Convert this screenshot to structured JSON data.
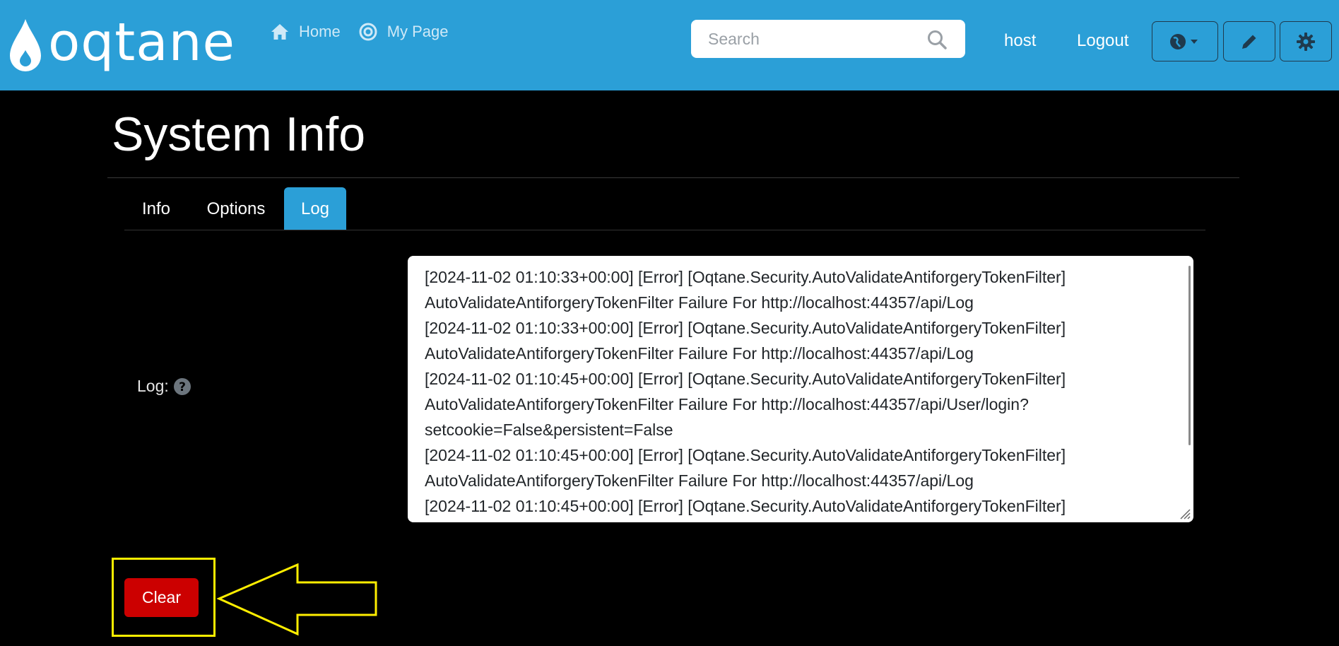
{
  "navbar": {
    "brand_text": "oqtane",
    "links": [
      {
        "label": "Home",
        "icon": "home-icon"
      },
      {
        "label": "My Page",
        "icon": "target-icon"
      }
    ],
    "search": {
      "placeholder": "Search",
      "value": ""
    },
    "user_label": "host",
    "logout_label": "Logout",
    "tools": [
      "language-icon",
      "pencil-icon",
      "gear-icon"
    ]
  },
  "page": {
    "title": "System Info",
    "tabs": [
      {
        "label": "Info",
        "active": false
      },
      {
        "label": "Options",
        "active": false
      },
      {
        "label": "Log",
        "active": true
      }
    ],
    "log_label": "Log:",
    "log_text": "[2024-11-02 01:10:33+00:00] [Error] [Oqtane.Security.AutoValidateAntiforgeryTokenFilter]\nAutoValidateAntiforgeryTokenFilter Failure For http://localhost:44357/api/Log\n[2024-11-02 01:10:33+00:00] [Error] [Oqtane.Security.AutoValidateAntiforgeryTokenFilter]\nAutoValidateAntiforgeryTokenFilter Failure For http://localhost:44357/api/Log\n[2024-11-02 01:10:45+00:00] [Error] [Oqtane.Security.AutoValidateAntiforgeryTokenFilter]\nAutoValidateAntiforgeryTokenFilter Failure For http://localhost:44357/api/User/login?\nsetcookie=False&persistent=False\n[2024-11-02 01:10:45+00:00] [Error] [Oqtane.Security.AutoValidateAntiforgeryTokenFilter]\nAutoValidateAntiforgeryTokenFilter Failure For http://localhost:44357/api/Log\n[2024-11-02 01:10:45+00:00] [Error] [Oqtane.Security.AutoValidateAntiforgeryTokenFilter]",
    "clear_label": "Clear"
  },
  "colors": {
    "navbar": "#2b9fd7",
    "clear_button": "#cc0000",
    "highlight": "#ffee00"
  }
}
